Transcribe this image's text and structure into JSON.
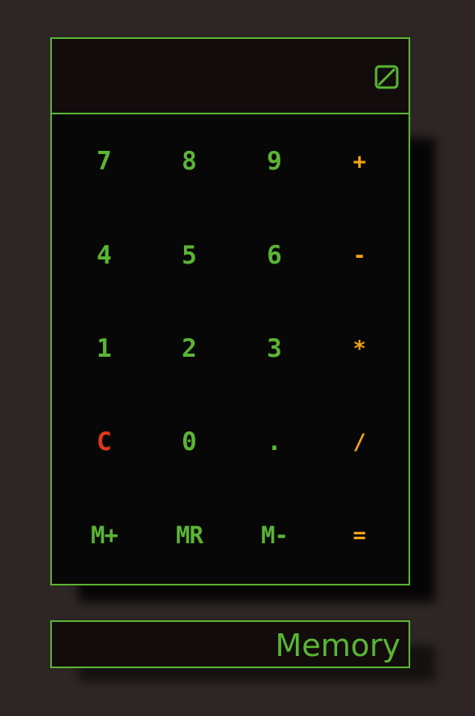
{
  "display": {
    "value": "",
    "icon": "empty-set-icon"
  },
  "keypad": {
    "rows": [
      [
        {
          "label": "7",
          "name": "key-7",
          "kind": "digit"
        },
        {
          "label": "8",
          "name": "key-8",
          "kind": "digit"
        },
        {
          "label": "9",
          "name": "key-9",
          "kind": "digit"
        },
        {
          "label": "+",
          "name": "key-add",
          "kind": "op"
        }
      ],
      [
        {
          "label": "4",
          "name": "key-4",
          "kind": "digit"
        },
        {
          "label": "5",
          "name": "key-5",
          "kind": "digit"
        },
        {
          "label": "6",
          "name": "key-6",
          "kind": "digit"
        },
        {
          "label": "-",
          "name": "key-subtract",
          "kind": "op"
        }
      ],
      [
        {
          "label": "1",
          "name": "key-1",
          "kind": "digit"
        },
        {
          "label": "2",
          "name": "key-2",
          "kind": "digit"
        },
        {
          "label": "3",
          "name": "key-3",
          "kind": "digit"
        },
        {
          "label": "*",
          "name": "key-multiply",
          "kind": "op"
        }
      ],
      [
        {
          "label": "C",
          "name": "key-clear",
          "kind": "clear"
        },
        {
          "label": "0",
          "name": "key-0",
          "kind": "digit"
        },
        {
          "label": ".",
          "name": "key-decimal",
          "kind": "digit"
        },
        {
          "label": "/",
          "name": "key-divide",
          "kind": "op"
        }
      ],
      [
        {
          "label": "M+",
          "name": "key-memory-add",
          "kind": "mem"
        },
        {
          "label": "MR",
          "name": "key-memory-recall",
          "kind": "mem"
        },
        {
          "label": "M-",
          "name": "key-memory-subtract",
          "kind": "mem"
        },
        {
          "label": "=",
          "name": "key-equals",
          "kind": "op"
        }
      ]
    ]
  },
  "memory": {
    "label": "Memory"
  },
  "colors": {
    "background": "#2d2624",
    "border": "#5ab534",
    "digit": "#5ab534",
    "operator": "#f0a313",
    "clear": "#e2381a"
  }
}
